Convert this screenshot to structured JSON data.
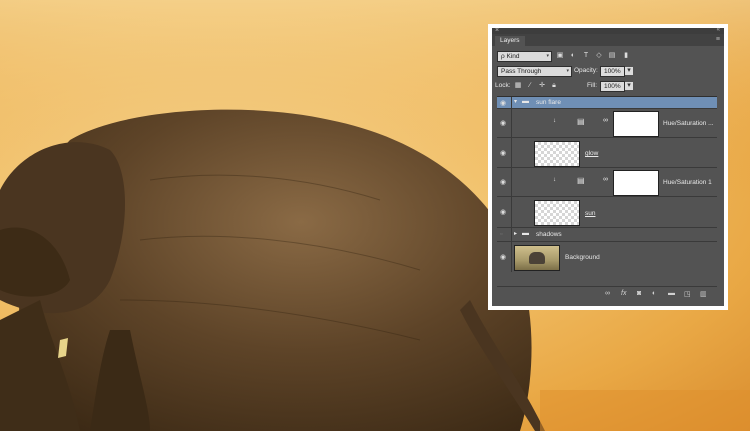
{
  "panel": {
    "close_glyph": "×",
    "collapse_glyph": "«",
    "tab_label": "Layers",
    "menu_glyph": "≡",
    "filter_value": "ρ Kind",
    "blend_mode": "Pass Through",
    "opacity_label": "Opacity:",
    "opacity_value": "100%",
    "lock_label": "Lock:",
    "fill_label": "Fill:",
    "fill_value": "100%"
  },
  "layers": [
    {
      "name": "sun flare",
      "type": "group",
      "visible": true,
      "selected": true,
      "expanded": true
    },
    {
      "name": "Hue/Saturation ...",
      "type": "adjustment",
      "visible": true,
      "clipped": true
    },
    {
      "name": "glow",
      "type": "pixel",
      "visible": true
    },
    {
      "name": "Hue/Saturation 1",
      "type": "adjustment",
      "visible": true,
      "clipped": true
    },
    {
      "name": "sun",
      "type": "pixel",
      "visible": true
    },
    {
      "name": "shadows",
      "type": "group",
      "visible": false,
      "expanded": false
    },
    {
      "name": "Background",
      "type": "background",
      "visible": true
    }
  ],
  "icons": {
    "eye": "eye-icon",
    "folder": "folder-icon",
    "link": "link-icon",
    "fx": "fx-icon",
    "mask": "mask-icon",
    "adjustment": "adjustment-icon",
    "new_group": "new-group-icon",
    "new_layer": "new-layer-icon",
    "trash": "trash-icon"
  },
  "colors": {
    "panel_bg": "#535353",
    "selection": "#6f8fb5",
    "sky": "#f2c26c"
  }
}
